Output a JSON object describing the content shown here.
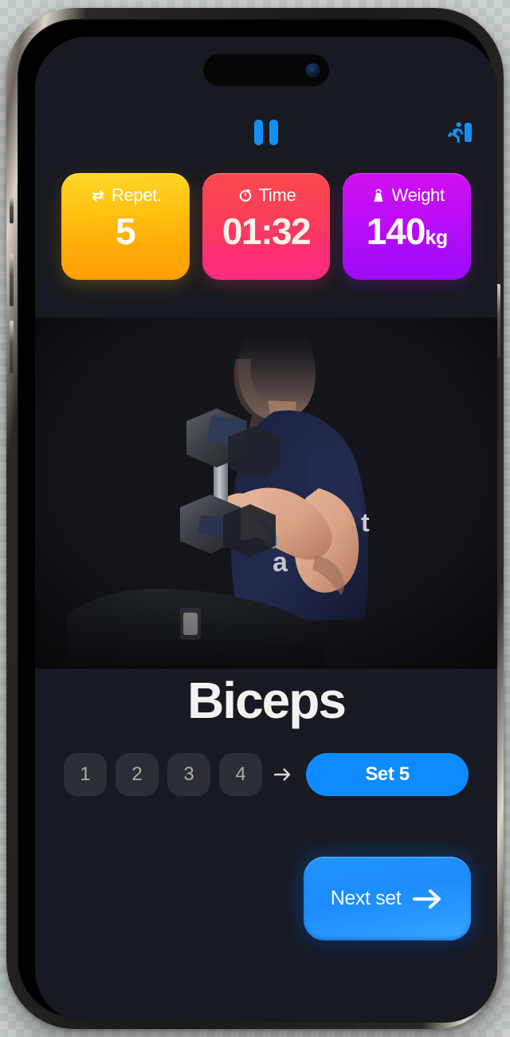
{
  "app": {
    "screen_name": "Workout Session",
    "background_color": "#171a20"
  },
  "top_bar": {
    "pause_button": {
      "name": "pause",
      "icon": "pause-icon",
      "color": "#1291f5"
    },
    "exit_button": {
      "name": "Finish workout",
      "icon": "running-person-exit-icon",
      "color": "#1291f5"
    }
  },
  "stats": [
    {
      "key": "reps",
      "label": "Repet.",
      "icon": "repeat-arrows-icon",
      "value": "5",
      "unit": "",
      "gradient_from": "#ffd728",
      "gradient_to": "#ffa005"
    },
    {
      "key": "time",
      "label": "Time",
      "icon": "stopwatch-icon",
      "value": "01:32",
      "unit": "",
      "gradient_from": "#fb4a4e",
      "gradient_to": "#fb2b80"
    },
    {
      "key": "weight",
      "label": "Weight",
      "icon": "kettlebell-icon",
      "value": "140",
      "unit": "kg",
      "gradient_from": "#d110f0",
      "gradient_to": "#9d0bfa"
    }
  ],
  "exercise": {
    "name": "Biceps",
    "media_alt": "Man seated performing dumbbell biceps curl"
  },
  "sets": {
    "completed": [
      "1",
      "2",
      "3",
      "4"
    ],
    "arrow_icon": "arrow-right-icon",
    "current_label": "Set 5",
    "current_color": "#0d8bff"
  },
  "next_set_button": {
    "label": "Next set",
    "icon": "arrow-right-icon",
    "color": "#2196ff"
  }
}
